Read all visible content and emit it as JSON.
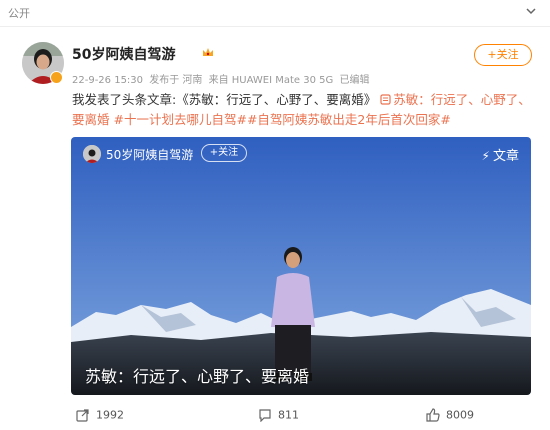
{
  "topbar": {
    "label": "公开"
  },
  "post": {
    "username": "50岁阿姨自驾游",
    "follow_label": "+关注",
    "meta": {
      "time": "22-9-26 15:30",
      "published_in": "发布于 河南",
      "source": "来自 HUAWEI Mate 30 5G",
      "edited": "已编辑"
    },
    "text_prefix": "我发表了头条文章:《苏敏：行远了、心野了、要离婚》",
    "article_link": "苏敏：行远了、心野了、要离婚",
    "hashtag_1": "#十一计划去哪儿自驾#",
    "hashtag_2": "#自驾阿姨苏敏出走2年后首次回家#"
  },
  "media": {
    "author": "50岁阿姨自驾游",
    "follow_label": "+关注",
    "article_label": "文章",
    "title": "苏敏：行远了、心野了、要离婚"
  },
  "actions": {
    "share_count": "1992",
    "comment_count": "811",
    "like_count": "8009"
  },
  "colors": {
    "accent": "#ff8200",
    "link": "#eb7350",
    "sky_top": "#2f5fc0",
    "sky_bottom": "#7fa6e0"
  }
}
